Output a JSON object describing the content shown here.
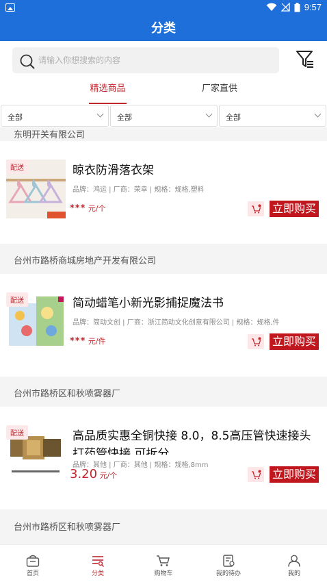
{
  "status_bar": {
    "time": "9:57"
  },
  "header": {
    "title": "分类"
  },
  "search": {
    "placeholder": "请输入你想搜索的内容"
  },
  "tabs": [
    {
      "label": "精选商品",
      "active": true
    },
    {
      "label": "厂家直供",
      "active": false
    }
  ],
  "filters": [
    {
      "value": "全部"
    },
    {
      "value": "全部"
    },
    {
      "value": "全部"
    }
  ],
  "partial_top_company": "东明开关有限公司",
  "products": [
    {
      "tag": "配送",
      "name": "晾衣防滑落衣架",
      "meta": "品牌：鸿运 | 厂商：荣幸 | 规格：规格,塑料",
      "price": "***",
      "unit": "元/个",
      "buy_label": "立即购买"
    },
    {
      "company": "台州市路桥商城房地产开发有限公司",
      "tag": "配送",
      "name": "简动蜡笔小新光影捕捉魔法书",
      "meta": "品牌：简动文创 | 厂商：浙江简动文化创意有限公司 | 规格：规格,件",
      "price": "***",
      "unit": "元/件",
      "buy_label": "立即购买"
    },
    {
      "company": "台州市路桥区和秋喷雾器厂",
      "tag": "配送",
      "name": "高品质实惠全铜快接 8.0，8.5高压管快速接头 打药管快接 可拆分",
      "meta": "品牌：其他 | 厂商：其他 | 规格：规格,8mm",
      "price": "3.20",
      "unit": "元/个",
      "buy_label": "立即购买"
    }
  ],
  "bottom_company": "台州市路桥区和秋喷雾器厂",
  "bottom_nav": [
    {
      "label": "首页",
      "icon": "home-icon",
      "active": false
    },
    {
      "label": "分类",
      "icon": "category-icon",
      "active": true
    },
    {
      "label": "购物车",
      "icon": "cart-icon",
      "active": false
    },
    {
      "label": "我的待办",
      "icon": "todo-icon",
      "active": false
    },
    {
      "label": "我的",
      "icon": "user-icon",
      "active": false
    }
  ],
  "colors": {
    "primary_blue": "#1e6fd9",
    "accent_red": "#c0272d",
    "buy_red": "#c0171e"
  }
}
